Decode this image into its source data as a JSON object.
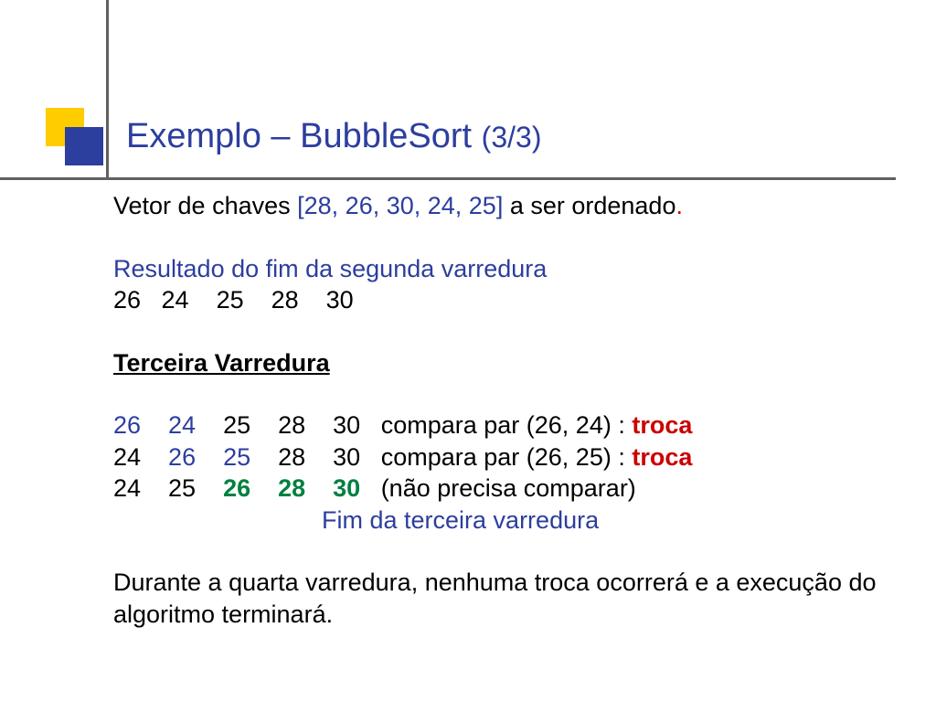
{
  "title": {
    "main": "Exemplo – BubbleSort ",
    "part": "(3/3)"
  },
  "intro": {
    "prefix": "Vetor de chaves ",
    "vector": "[28, 26, 30, 24, 25]",
    "suffix": " a ser ordenado",
    "dot": "."
  },
  "second_pass": {
    "label": "Resultado do fim da segunda varredura",
    "nums": "26   24    25    28    30"
  },
  "third_pass": {
    "heading": "Terceira Varredura",
    "line1": {
      "pair": "26    24",
      "rest": "    25    28    30   compara par (26, 24) : ",
      "action": "troca"
    },
    "line2": {
      "p1": "24    ",
      "pair": "26    25",
      "rest": "    28    30   compara par (26, 25) : ",
      "action": "troca"
    },
    "line3": {
      "p1": "24    25    ",
      "sorted": "26    28    30",
      "rest": "   (não precisa comparar)"
    },
    "end": "Fim da terceira varredura"
  },
  "final": "Durante a quarta varredura, nenhuma troca ocorrerá e a execução do algoritmo terminará."
}
